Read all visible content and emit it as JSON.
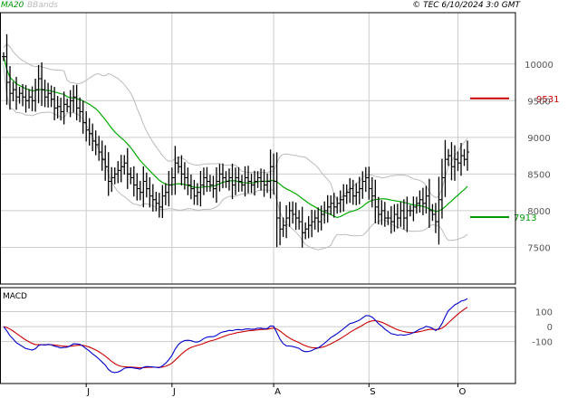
{
  "header": {
    "indicator_ma": "MA20",
    "indicator_bb": "BBands",
    "copyright": "© TEC 6/10/2024 3:0 GMT"
  },
  "colors": {
    "price": "#000000",
    "ma": "#00aa00",
    "bands": "#bbbbbb",
    "grid": "#cccccc",
    "resistance": "#cc0000",
    "support": "#009900",
    "macd": "#0000cc",
    "signal": "#cc0000"
  },
  "chart_data": [
    {
      "type": "line",
      "title": "",
      "y_ticks": [
        7500,
        8000,
        8500,
        9000,
        9500,
        10000
      ],
      "y_tick_labels": [
        "7500",
        "8000",
        "8500",
        "9000",
        "9500",
        "10000"
      ],
      "ylim": [
        7000,
        10700
      ],
      "x_ticks": [
        {
          "label": "J",
          "index": 26
        },
        {
          "label": "J",
          "index": 53
        },
        {
          "label": "A",
          "index": 85
        },
        {
          "label": "S",
          "index": 115
        },
        {
          "label": "O",
          "index": 143
        }
      ],
      "levels": [
        {
          "label": "9531",
          "value": 9531,
          "color": "#cc0000"
        },
        {
          "label": "7913",
          "value": 7913,
          "color": "#009900"
        }
      ],
      "close": [
        10100,
        9750,
        9600,
        9650,
        9550,
        9600,
        9550,
        9500,
        9550,
        9500,
        9650,
        9800,
        9650,
        9550,
        9600,
        9520,
        9400,
        9420,
        9350,
        9450,
        9420,
        9500,
        9550,
        9400,
        9350,
        9200,
        9100,
        9050,
        8950,
        8900,
        8800,
        8700,
        8600,
        8400,
        8450,
        8500,
        8550,
        8600,
        8650,
        8500,
        8450,
        8350,
        8300,
        8250,
        8400,
        8300,
        8200,
        8150,
        8100,
        8050,
        8200,
        8250,
        8350,
        8450,
        8650,
        8600,
        8500,
        8450,
        8350,
        8300,
        8200,
        8250,
        8350,
        8450,
        8400,
        8350,
        8300,
        8400,
        8500,
        8450,
        8400,
        8450,
        8350,
        8450,
        8400,
        8350,
        8450,
        8400,
        8350,
        8400,
        8450,
        8400,
        8350,
        8400,
        8600,
        8400,
        7900,
        7750,
        7800,
        7900,
        8000,
        7950,
        7900,
        7850,
        7700,
        7750,
        7800,
        7850,
        7900,
        7850,
        7950,
        8000,
        8050,
        8100,
        8050,
        8100,
        8150,
        8200,
        8250,
        8300,
        8200,
        8250,
        8300,
        8400,
        8450,
        8300,
        8200,
        8050,
        7950,
        8000,
        7900,
        7900,
        7850,
        7950,
        7900,
        8000,
        7900,
        8000,
        8000,
        8050,
        8100,
        8150,
        8100,
        8200,
        8000,
        7950,
        7850,
        8150,
        8450,
        8700,
        8750,
        8600,
        8700,
        8650,
        8750,
        8700,
        8800
      ]
    },
    {
      "type": "line",
      "title": "MACD",
      "y_ticks": [
        -100,
        0,
        100
      ],
      "y_tick_labels": [
        "-100",
        "0",
        "100"
      ],
      "ylim": [
        -380,
        260
      ]
    }
  ]
}
